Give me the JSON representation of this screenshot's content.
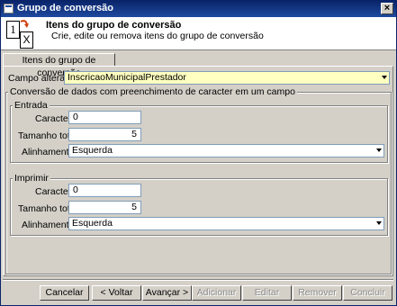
{
  "window": {
    "title": "Grupo de conversão",
    "close_glyph": "×"
  },
  "header": {
    "title": "Itens do grupo de conversão",
    "subtitle": "Crie, edite ou remova itens do grupo de conversão",
    "icon_left_glyph": "1",
    "icon_right_glyph": "X"
  },
  "tabs": [
    {
      "label": "Itens do grupo de conversão",
      "active": true
    }
  ],
  "form": {
    "campo_label": "Campo alterável:",
    "campo_value": "InscricaoMunicipalPrestador",
    "group_title": "Conversão de dados com preenchimento de caracter em um campo",
    "entrada": {
      "title": "Entrada",
      "caracter_label": "Caracter:",
      "caracter_value": "0",
      "tamanho_label": "Tamanho total:",
      "tamanho_value": "5",
      "alinhamento_label": "Alinhamento:",
      "alinhamento_value": "Esquerda"
    },
    "imprimir": {
      "title": "Imprimir",
      "caracter_label": "Caracter:",
      "caracter_value": "0",
      "tamanho_label": "Tamanho total:",
      "tamanho_value": "5",
      "alinhamento_label": "Alinhamento:",
      "alinhamento_value": "Esquerda"
    }
  },
  "buttons": {
    "cancelar": "Cancelar",
    "voltar": "< Voltar",
    "avancar": "Avançar >",
    "adicionar": "Adicionar",
    "editar": "Editar",
    "remover": "Remover",
    "concluir": "Concluir"
  },
  "colors": {
    "titlebar": "#0a246a",
    "face": "#d4d0c8",
    "highlight_field": "#ffffc0"
  }
}
